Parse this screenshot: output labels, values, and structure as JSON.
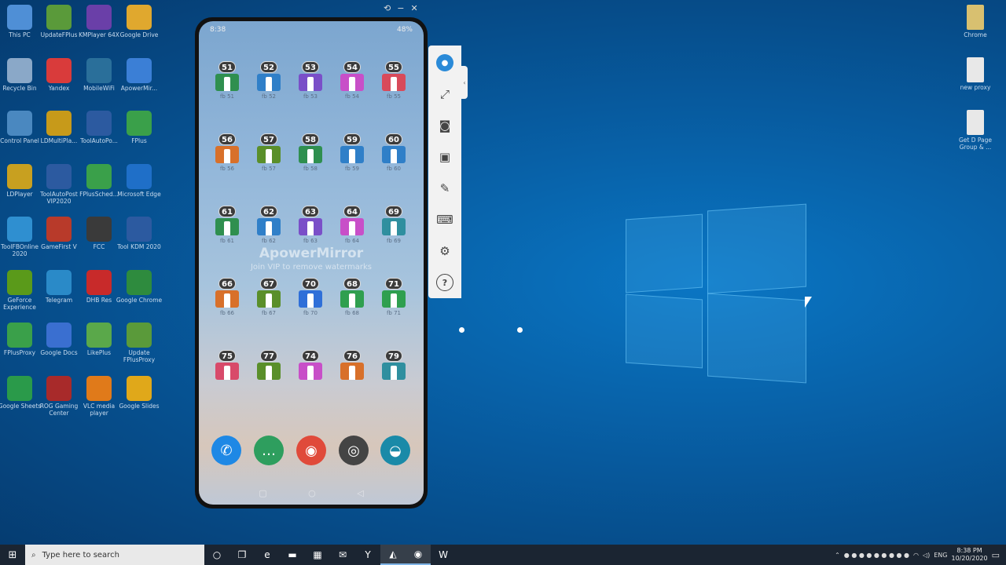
{
  "desktop_left": [
    {
      "label": "This PC",
      "icon": "computer-icon",
      "color": "#4f8fd6"
    },
    {
      "label": "UpdateFPlus",
      "icon": "update-icon",
      "color": "#5a9a3a"
    },
    {
      "label": "KMPlayer 64X",
      "icon": "kmplayer-icon",
      "color": "#6a3fa8"
    },
    {
      "label": "Google Drive",
      "icon": "drive-icon",
      "color": "#e0a82e"
    },
    {
      "label": "Recycle Bin",
      "icon": "recycle-bin-icon",
      "color": "#8aa8c8"
    },
    {
      "label": "Yandex",
      "icon": "yandex-icon",
      "color": "#d93b3b"
    },
    {
      "label": "MobileWiFi",
      "icon": "wifi-icon",
      "color": "#2a6f9a"
    },
    {
      "label": "ApowerMir...",
      "icon": "apowermirror-icon",
      "color": "#3b7fd6"
    },
    {
      "label": "Control Panel",
      "icon": "control-panel-icon",
      "color": "#4a88c0"
    },
    {
      "label": "LDMultiPla...",
      "icon": "ldmultiplayer-icon",
      "color": "#c79a1a"
    },
    {
      "label": "ToolAutoPo...",
      "icon": "toolautopost-icon",
      "color": "#2c5aa0"
    },
    {
      "label": "FPlus",
      "icon": "fplus-icon",
      "color": "#3aa04a"
    },
    {
      "label": "LDPlayer",
      "icon": "ldplayer-icon",
      "color": "#c8a020"
    },
    {
      "label": "ToolAutoPost VIP2020",
      "icon": "toolautopost-vip-icon",
      "color": "#2c5aa0"
    },
    {
      "label": "FPlusSched...",
      "icon": "fplus-scheduler-icon",
      "color": "#3aa04a"
    },
    {
      "label": "Microsoft Edge",
      "icon": "edge-icon",
      "color": "#1f6fc8"
    },
    {
      "label": "ToolFBOnline 2020",
      "icon": "toolfbonline-icon",
      "color": "#2f8fd0"
    },
    {
      "label": "GameFirst V",
      "icon": "gamefirst-icon",
      "color": "#b83a2a"
    },
    {
      "label": "FCC",
      "icon": "camera-icon",
      "color": "#3a3a3a"
    },
    {
      "label": "Tool KDM 2020",
      "icon": "facebook-icon",
      "color": "#2c5aa0"
    },
    {
      "label": "GeForce Experience",
      "icon": "geforce-icon",
      "color": "#5a9a1a"
    },
    {
      "label": "Telegram",
      "icon": "telegram-icon",
      "color": "#2a8ac8"
    },
    {
      "label": "DHB Res",
      "icon": "dhb-res-icon",
      "color": "#c82a2a"
    },
    {
      "label": "Google Chrome",
      "icon": "chrome-icon",
      "color": "#2e8b3e"
    },
    {
      "label": "FPlusProxy",
      "icon": "fplusproxy-icon",
      "color": "#3aa04a"
    },
    {
      "label": "Google Docs",
      "icon": "docs-icon",
      "color": "#3a6fd0"
    },
    {
      "label": "LikePlus",
      "icon": "likeplus-icon",
      "color": "#5aa84a"
    },
    {
      "label": "Update FPlusProxy",
      "icon": "update-icon",
      "color": "#5a9a3a"
    },
    {
      "label": "Google Sheets",
      "icon": "sheets-icon",
      "color": "#2a9a4a"
    },
    {
      "label": "ROG Gaming Center",
      "icon": "rog-icon",
      "color": "#a82a2a"
    },
    {
      "label": "VLC media player",
      "icon": "vlc-icon",
      "color": "#e07a1a"
    },
    {
      "label": "Google Slides",
      "icon": "slides-icon",
      "color": "#e0a81a"
    }
  ],
  "desktop_right": [
    {
      "label": "Chrome",
      "icon": "folder-icon",
      "color": "#d8c070"
    },
    {
      "label": "new proxy",
      "icon": "file-icon",
      "color": "#e8e8e8"
    },
    {
      "label": "Get D Page Group & ...",
      "icon": "file-icon",
      "color": "#e8e8e8"
    }
  ],
  "phone": {
    "status_time": "8:38",
    "status_battery": "48%",
    "watermark_title": "ApowerMirror",
    "watermark_sub": "Join VIP to remove watermarks",
    "apps": [
      {
        "num": "51",
        "label": "fb 51",
        "color": "#2f8f4f"
      },
      {
        "num": "52",
        "label": "fb 52",
        "color": "#2f7fc8"
      },
      {
        "num": "53",
        "label": "fb 53",
        "color": "#7a4fc8"
      },
      {
        "num": "54",
        "label": "fb 54",
        "color": "#c84fc8"
      },
      {
        "num": "55",
        "label": "fb 55",
        "color": "#d84a5a"
      },
      {
        "num": "56",
        "label": "fb 56",
        "color": "#d8702a"
      },
      {
        "num": "57",
        "label": "fb 57",
        "color": "#5a8f2a"
      },
      {
        "num": "58",
        "label": "fb 58",
        "color": "#2f8f4f"
      },
      {
        "num": "59",
        "label": "fb 59",
        "color": "#2f7fc8"
      },
      {
        "num": "60",
        "label": "fb 60",
        "color": "#2f7fc8"
      },
      {
        "num": "61",
        "label": "fb 61",
        "color": "#2f8f4f"
      },
      {
        "num": "62",
        "label": "fb 62",
        "color": "#2f7fc8"
      },
      {
        "num": "63",
        "label": "fb 63",
        "color": "#7a4fc8"
      },
      {
        "num": "64",
        "label": "fb 64",
        "color": "#c84fc8"
      },
      {
        "num": "69",
        "label": "fb 69",
        "color": "#2f8f9f"
      },
      {
        "num": "66",
        "label": "fb 66",
        "color": "#d8702a"
      },
      {
        "num": "67",
        "label": "fb 67",
        "color": "#5a8f2a"
      },
      {
        "num": "70",
        "label": "fb 70",
        "color": "#2f6fd8"
      },
      {
        "num": "68",
        "label": "fb 68",
        "color": "#2f9f4f"
      },
      {
        "num": "71",
        "label": "fb 71",
        "color": "#2f9f4f"
      },
      {
        "num": "75",
        "label": "",
        "color": "#d84a6a"
      },
      {
        "num": "77",
        "label": "",
        "color": "#5a8f2a"
      },
      {
        "num": "74",
        "label": "",
        "color": "#c84fc8"
      },
      {
        "num": "76",
        "label": "",
        "color": "#d8702a"
      },
      {
        "num": "79",
        "label": "",
        "color": "#2f8f9f"
      }
    ],
    "dock": [
      {
        "icon": "phone-icon",
        "glyph": "✆",
        "color": "#1e88e5"
      },
      {
        "icon": "messages-icon",
        "glyph": "…",
        "color": "#2e9e5e"
      },
      {
        "icon": "chrome-icon",
        "glyph": "◉",
        "color": "#e04a3a"
      },
      {
        "icon": "camera-icon",
        "glyph": "◎",
        "color": "#444444"
      },
      {
        "icon": "weather-icon",
        "glyph": "◒",
        "color": "#1a8aa8"
      }
    ]
  },
  "toolbar": [
    {
      "icon": "account-icon",
      "glyph": "●"
    },
    {
      "icon": "fullscreen-icon",
      "glyph": "⤢"
    },
    {
      "icon": "screenshot-icon",
      "glyph": "◙"
    },
    {
      "icon": "record-icon",
      "glyph": "▣"
    },
    {
      "icon": "brush-icon",
      "glyph": "✎"
    },
    {
      "icon": "keyboard-icon",
      "glyph": "⌨"
    },
    {
      "icon": "settings-icon",
      "glyph": "⚙"
    },
    {
      "icon": "help-icon",
      "glyph": "?"
    }
  ],
  "taskbar": {
    "search_placeholder": "Type here to search",
    "apps": [
      {
        "icon": "cortana-icon",
        "glyph": "○"
      },
      {
        "icon": "task-view-icon",
        "glyph": "❐"
      },
      {
        "icon": "edge-icon",
        "glyph": "e"
      },
      {
        "icon": "file-explorer-icon",
        "glyph": "▬"
      },
      {
        "icon": "store-icon",
        "glyph": "▦"
      },
      {
        "icon": "mail-icon",
        "glyph": "✉"
      },
      {
        "icon": "yandex-icon",
        "glyph": "Y"
      },
      {
        "icon": "apowermirror-icon",
        "glyph": "◭"
      },
      {
        "icon": "chrome-icon",
        "glyph": "◉"
      },
      {
        "icon": "word-icon",
        "glyph": "W"
      }
    ],
    "lang": "ENG",
    "time": "8:38 PM",
    "date": "10/20/2020"
  }
}
